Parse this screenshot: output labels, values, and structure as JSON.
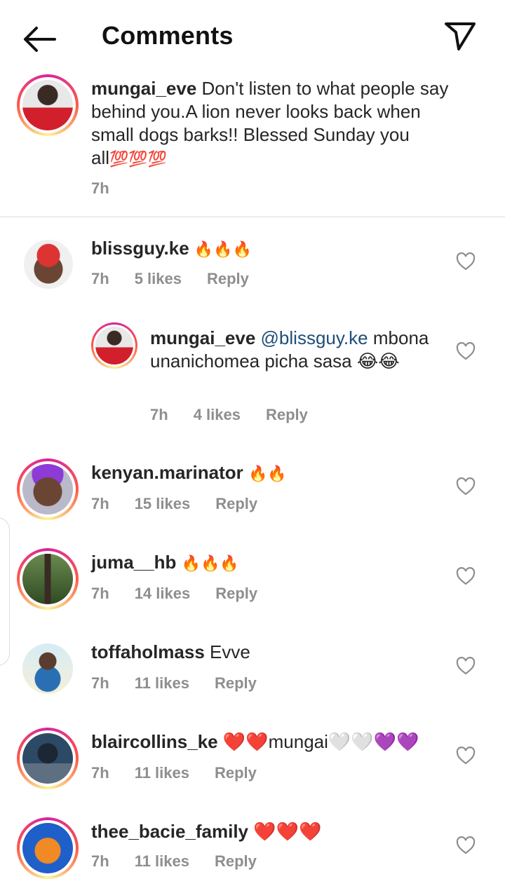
{
  "header": {
    "title": "Comments"
  },
  "caption": {
    "username": "mungai_eve",
    "text": "Don't listen to what people say behind you.A lion never looks back when small dogs barks!! Blessed Sunday you all",
    "emojis": "💯💯💯",
    "time": "7h"
  },
  "comments": [
    {
      "username": "blissguy.ke",
      "text": "🔥🔥🔥",
      "time": "7h",
      "likes": "5 likes",
      "reply": "Reply"
    },
    {
      "username": "mungai_eve",
      "mention": "@blissguy.ke",
      "text": "mbona unanichomea picha sasa 😂😂",
      "time": "7h",
      "likes": "4 likes",
      "reply": "Reply"
    },
    {
      "username": "kenyan.marinator",
      "text": "🔥🔥",
      "time": "7h",
      "likes": "15 likes",
      "reply": "Reply"
    },
    {
      "username": "juma__hb",
      "text": "🔥🔥🔥",
      "time": "7h",
      "likes": "14 likes",
      "reply": "Reply"
    },
    {
      "username": "toffaholmass",
      "text": "Evve",
      "time": "7h",
      "likes": "11 likes",
      "reply": "Reply"
    },
    {
      "username": "blaircollins_ke",
      "text": "❤️❤️mungai🤍🤍💜💜",
      "time": "7h",
      "likes": "11 likes",
      "reply": "Reply"
    },
    {
      "username": "thee_bacie_family",
      "text": "❤️❤️❤️",
      "time": "7h",
      "likes": "11 likes",
      "reply": "Reply"
    }
  ],
  "icons": [
    "back-arrow-icon",
    "send-icon",
    "heart-icon"
  ],
  "colors": {
    "meta": "#8e8e8e",
    "mention": "#1e4e79",
    "divider": "#dbdbdb"
  }
}
